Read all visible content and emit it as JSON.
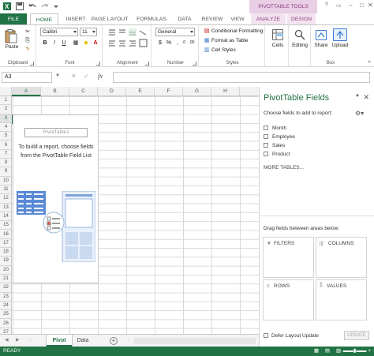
{
  "title_bar": {
    "contextual_group": "PIVOTTABLE TOOLS",
    "window_controls": [
      "?",
      "▭",
      "–",
      "□",
      "✕"
    ]
  },
  "tabs": {
    "file": "FILE",
    "home": "HOME",
    "insert": "INSERT",
    "page_layout": "PAGE LAYOUT",
    "formulas": "FORMULAS",
    "data": "DATA",
    "review": "REVIEW",
    "view": "VIEW",
    "analyze": "ANALYZE",
    "design": "DESIGN"
  },
  "ribbon": {
    "clipboard": {
      "label": "Clipboard",
      "paste": "Paste"
    },
    "font": {
      "label": "Font",
      "name": "Calibri",
      "size": "11",
      "bold": "B",
      "italic": "I",
      "underline": "U"
    },
    "alignment": {
      "label": "Alignment"
    },
    "number": {
      "label": "Number",
      "format": "General",
      "currency": "$",
      "percent": "%",
      "comma": ",",
      "inc": ".0",
      "dec": ".00"
    },
    "styles": {
      "label": "Styles",
      "conditional": "Conditional Formatting",
      "format_table": "Format as Table",
      "cell_styles": "Cell Styles"
    },
    "cells": {
      "label": "Cells"
    },
    "editing": {
      "label": "Editing"
    },
    "share": {
      "label": "Share"
    },
    "upload": {
      "label": "Upload"
    },
    "box_group": {
      "label": "Box"
    }
  },
  "formula_bar": {
    "name_box": "A3",
    "fx": "fx",
    "cancel": "✕",
    "enter": "✓"
  },
  "grid": {
    "columns": [
      "A",
      "B",
      "C",
      "D",
      "E",
      "F",
      "G",
      "H"
    ],
    "rows": [
      "1",
      "2",
      "3",
      "4",
      "5",
      "6",
      "7",
      "8",
      "9",
      "10",
      "11",
      "12",
      "13",
      "14",
      "15",
      "16",
      "17",
      "18",
      "19",
      "20",
      "21",
      "22",
      "23",
      "24",
      "25",
      "26",
      "27"
    ]
  },
  "pivot_placeholder": {
    "name": "PivotTable1",
    "instruction": "To build a report, choose fields from the PivotTable Field List"
  },
  "sheet_tabs": {
    "tabs": [
      "Pivot",
      "Data"
    ],
    "add": "+"
  },
  "status": {
    "text": "READY"
  },
  "pivot_pane": {
    "title": "PivotTable Fields",
    "subtitle": "Choose fields to add to report:",
    "fields": [
      "Month",
      "Employee",
      "Sales",
      "Product"
    ],
    "more_tables": "MORE TABLES...",
    "drag_label": "Drag fields between areas below:",
    "areas": {
      "filters": "FILTERS",
      "columns": "COLUMNS",
      "rows": "ROWS",
      "values": "VALUES"
    },
    "defer": "Defer Layout Update",
    "update": "UPDATE"
  },
  "colors": {
    "excel_green": "#217346",
    "pivot_tools": "#8a3e7f",
    "pivot_tools_bg": "#e9cfe5"
  }
}
